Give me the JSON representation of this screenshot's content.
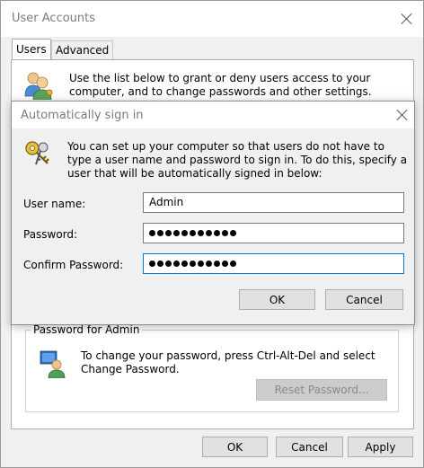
{
  "user_accounts": {
    "title": "User Accounts",
    "tabs": [
      {
        "label": "Users",
        "active": true
      },
      {
        "label": "Advanced",
        "active": false
      }
    ],
    "info_text": "Use the list below to grant or deny users access to your computer, and to change passwords and other settings.",
    "password_group": {
      "title": "Password for Admin",
      "text": "To change your password, press Ctrl-Alt-Del and select Change Password.",
      "reset_button": "Reset Password..."
    },
    "buttons": {
      "ok": "OK",
      "cancel": "Cancel",
      "apply": "Apply"
    },
    "icons": [
      "users-icon",
      "user-key-icon",
      "close-icon"
    ]
  },
  "auto_sign_in": {
    "title": "Automatically sign in",
    "info_text": "You can set up your computer so that users do not have to type a user name and password to sign in. To do this, specify a user that will be automatically signed in below:",
    "fields": {
      "username_label": "User name:",
      "username_value": "Admin",
      "password_label": "Password:",
      "password_mask_count": 11,
      "confirm_label": "Confirm Password:",
      "confirm_mask_count": 11
    },
    "buttons": {
      "ok": "OK",
      "cancel": "Cancel"
    },
    "icons": [
      "keys-icon",
      "close-icon"
    ]
  },
  "colors": {
    "focus_border": "#0078d7",
    "button_bg": "#e1e1e1",
    "window_bg": "#f0f0f0"
  }
}
